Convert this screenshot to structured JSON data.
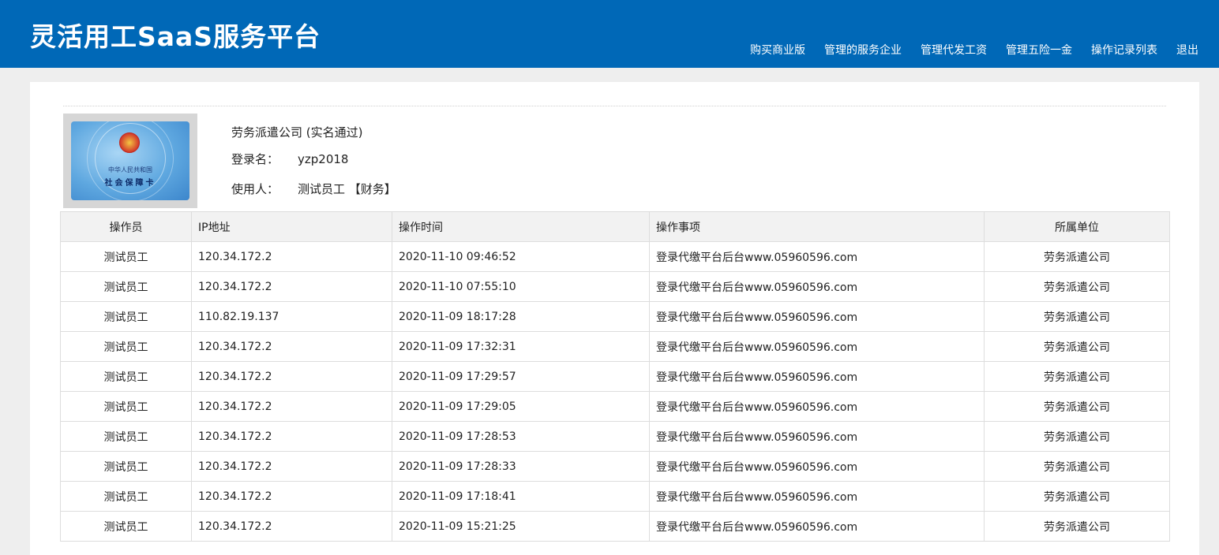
{
  "header": {
    "brand": "灵活用工SaaS服务平台",
    "nav": [
      "购买商业版",
      "管理的服务企业",
      "管理代发工资",
      "管理五险一金",
      "操作记录列表",
      "退出"
    ]
  },
  "profile": {
    "company": "劳务派遣公司 (实名通过)",
    "login_label": "登录名：",
    "login_value": "yzp2018",
    "user_label": "使用人：",
    "user_value": "测试员工 【财务】",
    "card_line1": "中华人民共和国",
    "card_line2": "社会保障卡"
  },
  "table": {
    "columns": [
      "操作员",
      "IP地址",
      "操作时间",
      "操作事项",
      "所属单位"
    ],
    "rows": [
      [
        "测试员工",
        "120.34.172.2",
        "2020-11-10 09:46:52",
        "登录代缴平台后台www.05960596.com",
        "劳务派遣公司"
      ],
      [
        "测试员工",
        "120.34.172.2",
        "2020-11-10 07:55:10",
        "登录代缴平台后台www.05960596.com",
        "劳务派遣公司"
      ],
      [
        "测试员工",
        "110.82.19.137",
        "2020-11-09 18:17:28",
        "登录代缴平台后台www.05960596.com",
        "劳务派遣公司"
      ],
      [
        "测试员工",
        "120.34.172.2",
        "2020-11-09 17:32:31",
        "登录代缴平台后台www.05960596.com",
        "劳务派遣公司"
      ],
      [
        "测试员工",
        "120.34.172.2",
        "2020-11-09 17:29:57",
        "登录代缴平台后台www.05960596.com",
        "劳务派遣公司"
      ],
      [
        "测试员工",
        "120.34.172.2",
        "2020-11-09 17:29:05",
        "登录代缴平台后台www.05960596.com",
        "劳务派遣公司"
      ],
      [
        "测试员工",
        "120.34.172.2",
        "2020-11-09 17:28:53",
        "登录代缴平台后台www.05960596.com",
        "劳务派遣公司"
      ],
      [
        "测试员工",
        "120.34.172.2",
        "2020-11-09 17:28:33",
        "登录代缴平台后台www.05960596.com",
        "劳务派遣公司"
      ],
      [
        "测试员工",
        "120.34.172.2",
        "2020-11-09 17:18:41",
        "登录代缴平台后台www.05960596.com",
        "劳务派遣公司"
      ],
      [
        "测试员工",
        "120.34.172.2",
        "2020-11-09 15:21:25",
        "登录代缴平台后台www.05960596.com",
        "劳务派遣公司"
      ]
    ]
  }
}
